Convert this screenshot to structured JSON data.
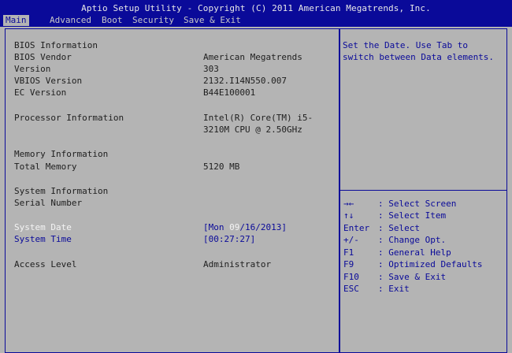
{
  "header": {
    "title": "Aptio Setup Utility - Copyright (C) 2011 American Megatrends, Inc.",
    "tabs": [
      "Main",
      "Advanced",
      "Boot",
      "Security",
      "Save & Exit"
    ]
  },
  "main": {
    "bios_heading": "BIOS Information",
    "bios_vendor_label": "BIOS Vendor",
    "bios_vendor_value": "American Megatrends",
    "version_label": "Version",
    "version_value": "303",
    "vbios_label": "VBIOS Version",
    "vbios_value": "2132.I14N550.007",
    "ec_label": "EC Version",
    "ec_value": "B44E100001",
    "processor_label": "Processor Information",
    "processor_value_1": "Intel(R) Core(TM) i5-",
    "processor_value_2": "3210M CPU @ 2.50GHz",
    "memory_heading": "Memory Information",
    "total_memory_label": "Total Memory",
    "total_memory_value": "5120 MB",
    "system_heading": "System Information",
    "serial_label": "Serial Number",
    "date_label": "System Date",
    "date_prefix": "[Mon ",
    "date_month": "09",
    "date_suffix": "/16/2013]",
    "time_label": "System Time",
    "time_value": "[00:27:27]",
    "access_label": "Access Level",
    "access_value": "Administrator"
  },
  "help": {
    "text": "Set the Date. Use Tab to switch between Data elements."
  },
  "keys": [
    {
      "key": "→←",
      "desc": ": Select Screen"
    },
    {
      "key": "↑↓",
      "desc": ": Select Item"
    },
    {
      "key": "Enter",
      "desc": ": Select"
    },
    {
      "key": "+/-",
      "desc": ": Change Opt."
    },
    {
      "key": "F1",
      "desc": ": General Help"
    },
    {
      "key": "F9",
      "desc": ": Optimized Defaults"
    },
    {
      "key": "F10",
      "desc": ": Save & Exit"
    },
    {
      "key": "ESC",
      "desc": ": Exit"
    }
  ],
  "colors": {
    "background": "#b4b4b4",
    "accent_blue": "#0a0a99",
    "highlight": "#f4f4f4"
  }
}
